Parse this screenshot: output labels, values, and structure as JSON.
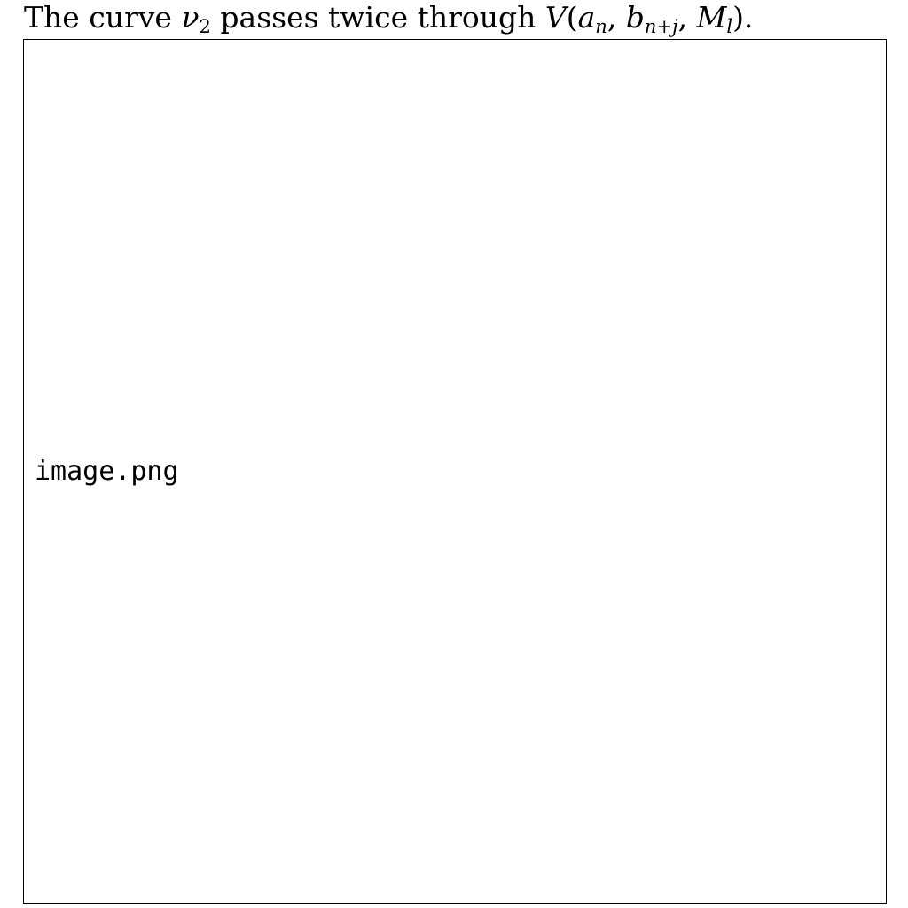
{
  "caption": {
    "prefix": "The curve ",
    "symbol": "ν",
    "symbol_sub": "2",
    "middle": " passes twice through ",
    "func": "V",
    "open": "(",
    "arg1": "a",
    "arg1_sub": "n",
    "sep1": ", ",
    "arg2": "b",
    "arg2_sub": "n+j",
    "sep2": ", ",
    "arg3": "M",
    "arg3_sub": "l",
    "close": ").",
    "full_text": "The curve ν2 passes twice through V(an, bn+j, Ml)."
  },
  "figure": {
    "placeholder_text": "image.png",
    "border_color": "#000000",
    "background_color": "#ffffff"
  }
}
